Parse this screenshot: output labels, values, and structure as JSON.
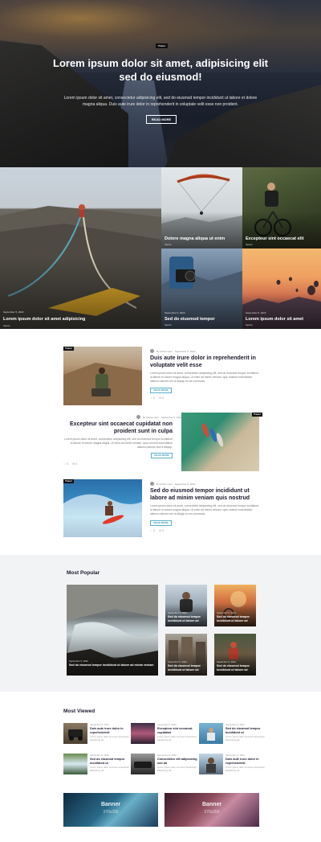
{
  "hero": {
    "badge": "Travel",
    "title": "Lorem ipsum dolor sit amet, adipisicing elit sed do eiusmod!",
    "text": "Lorem ipsum dolor sit amet, consectetur adipisicing elit, sed do eiusmod tempor incididunt ut labore et dolore magna aliqua. Duis aute irure dolor in reprehenderit in voluptate velit esse non proident.",
    "button": "READ MORE"
  },
  "grid": [
    {
      "date": "September 5, 2022",
      "title": "Lorem ipsum dolor sit amet adipisicing",
      "category": "Sports"
    },
    {
      "date": "September 5, 2022",
      "title": "Dolore magna aliqua ut enim",
      "category": "Sports"
    },
    {
      "date": "September 5, 2022",
      "title": "Excepteur sint occaecat elit",
      "category": "Sports"
    },
    {
      "date": "September 5, 2022",
      "title": "Sed do eiusmod tempor",
      "category": "Sports"
    },
    {
      "date": "September 5, 2022",
      "title": "Lorem ipsum dolor sit amet",
      "category": "Sports"
    }
  ],
  "articles": [
    {
      "badge": "Travel",
      "author": "By Admin User",
      "date": "September 5, 2022",
      "title": "Duis aute irure dolor in reprehenderit in voluptate velit esse",
      "text": "Lorem ipsum dolor sit amet, consectetur adipisicing elit, sed do eiusmod tempor incididunt ut labore et dolore magna aliqua. Ut enim ad minim veniam, quis nostrud exercitation ullamco laboris nisi ut aliquip ex ea commodo.",
      "button": "READ MORE",
      "likes": "0",
      "comments": "0"
    },
    {
      "badge": "Travel",
      "author": "By Admin User",
      "date": "September 5, 2022",
      "title": "Excepteur sint occaecat cupidatat non proident sunt in culpa",
      "text": "Lorem ipsum dolor sit amet, consectetur adipisicing elit, sed do eiusmod tempor incididunt ut labore et dolore magna aliqua. Ut enim ad minim veniam, quis nostrud exercitation ullamco laboris nisi ut aliquip.",
      "button": "READ MORE",
      "likes": "0",
      "comments": "0"
    },
    {
      "badge": "Travel",
      "author": "By Admin User",
      "date": "September 5, 2022",
      "title": "Sed do eiusmod tempor incididunt ut labore ad minim veniam quis nostrud",
      "text": "Lorem ipsum dolor sit amet, consectetur adipisicing elit, sed do eiusmod tempor incididunt ut labore et dolore magna aliqua. Ut enim ad minim veniam, quis nostrud exercitation ullamco laboris nisi ut aliquip ex ea commodo.",
      "button": "READ MORE",
      "likes": "0",
      "comments": "0"
    }
  ],
  "popular": {
    "title": "Most Popular",
    "items": [
      {
        "date": "September 5, 2022",
        "title": "Sed do eiusmod tempor incididunt ut labore ad minim veniam"
      },
      {
        "date": "September 5, 2022",
        "title": "Sed do eiusmod tempor incididunt ut labore ad"
      },
      {
        "date": "September 5, 2022",
        "title": "Sed do eiusmod tempor incididunt ut labore ad"
      },
      {
        "date": "September 5, 2022",
        "title": "Sed do eiusmod tempor incididunt ut labore ad"
      },
      {
        "date": "September 5, 2022",
        "title": "Sed do eiusmod tempor incididunt ut labore ad"
      }
    ]
  },
  "viewed": {
    "title": "Most Viewed",
    "items": [
      {
        "date": "September 5, 2022",
        "title": "Duis aute irure dolor in reprehenderit",
        "text": "Lorem ipsum dolor sit amet consectetur adipisicing elit"
      },
      {
        "date": "September 5, 2022",
        "title": "Excepteur sint occaecat cupidatat",
        "text": "Lorem ipsum dolor sit amet consectetur adipisicing elit"
      },
      {
        "date": "September 5, 2022",
        "title": "Sed do eiusmod tempor incididunt ut",
        "text": "Lorem ipsum dolor sit amet consectetur adipisicing elit"
      },
      {
        "date": "September 5, 2022",
        "title": "Sed do eiusmod tempor incididunt ut",
        "text": "Lorem ipsum dolor sit amet consectetur adipisicing elit"
      },
      {
        "date": "September 5, 2022",
        "title": "Consectetur elit adipisicing sed do",
        "text": "Lorem ipsum dolor sit amet consectetur adipisicing elit"
      },
      {
        "date": "September 5, 2022",
        "title": "Duis aute irure dolor in reprehenderit",
        "text": "Lorem ipsum dolor sit amet consectetur adipisicing elit"
      }
    ]
  },
  "banners": [
    {
      "label": "Banner",
      "size": "370x200"
    },
    {
      "label": "Banner",
      "size": "370x200"
    }
  ]
}
